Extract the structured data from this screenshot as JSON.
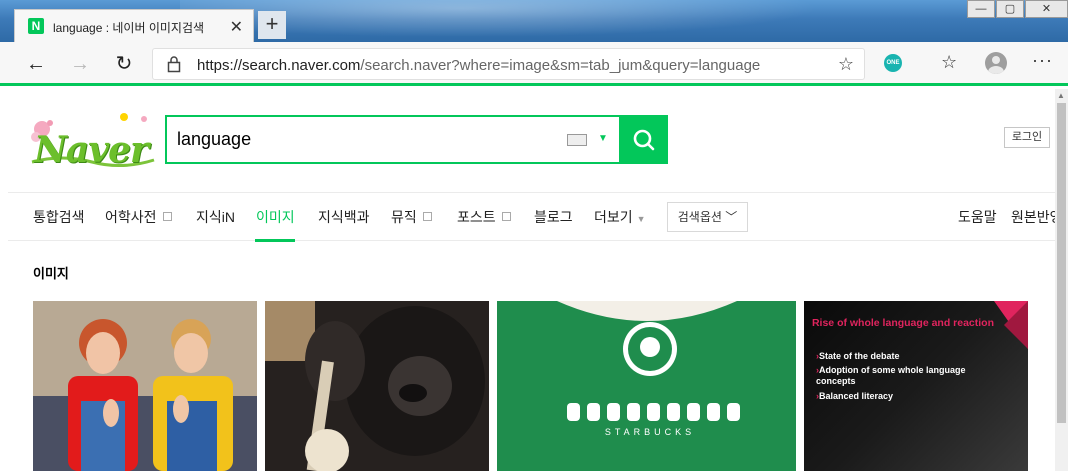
{
  "browser": {
    "tab_title": "language : 네이버 이미지검색",
    "favicon_letter": "N",
    "new_tab": "+",
    "url_host": "https://search.naver.com",
    "url_path": "/search.naver?where=image&sm=tab_jum&query=language",
    "extension_badge": "ONE"
  },
  "search": {
    "query": "language"
  },
  "header": {
    "login_label": "로그인"
  },
  "tabs": [
    {
      "label": "통합검색"
    },
    {
      "label": "어학사전"
    },
    {
      "label": "지식iN"
    },
    {
      "label": "이미지"
    },
    {
      "label": "지식백과"
    },
    {
      "label": "뮤직"
    },
    {
      "label": "포스트"
    },
    {
      "label": "블로그"
    },
    {
      "label": "더보기"
    }
  ],
  "search_options_label": "검색옵션",
  "right_links": {
    "help": "도움말",
    "original": "원본반영"
  },
  "section": {
    "title": "이미지"
  },
  "slide": {
    "title": "Rise of whole language and reaction",
    "bullets": [
      "State of the debate",
      "Adoption of some whole language concepts",
      "Balanced literacy"
    ]
  },
  "starbucks_text": "STARBUCKS",
  "colors": {
    "naver_green": "#03c75a",
    "slide_accent": "#e0245e"
  }
}
